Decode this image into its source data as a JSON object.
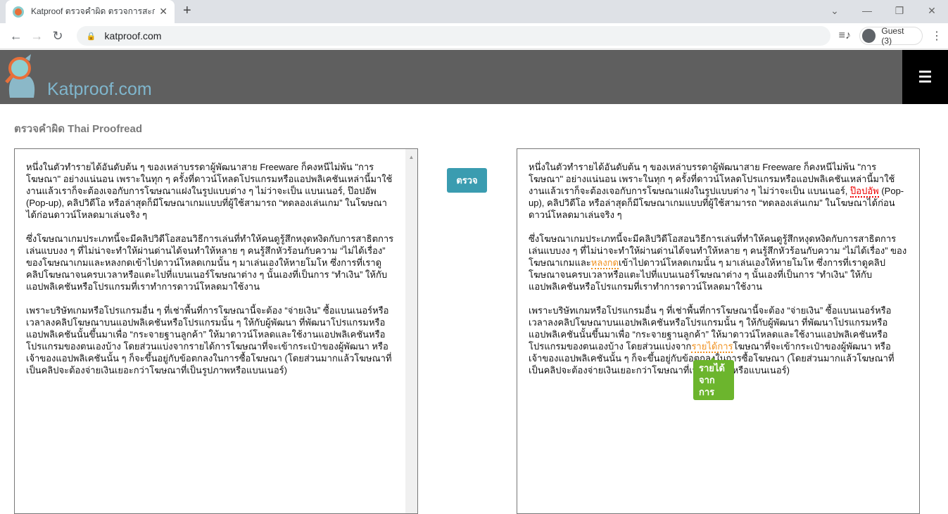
{
  "browser": {
    "tab_title": "Katproof ตรวจคำผิด ตรวจการสะกดคำ",
    "url": "katproof.com",
    "profile": "Guest (3)"
  },
  "site": {
    "brand": "Katproof.com",
    "page_title": "ตรวจคำผิด Thai Proofread",
    "check_button": "ตรวจ"
  },
  "input": {
    "paragraphs": [
      "หนึ่งในตัวทำรายได้อันดับต้น ๆ ของเหล่าบรรดาผู้พัฒนาสาย Freeware ก็คงหนีไม่พ้น \"การโฆษณา\" อย่างแน่นอน เพราะในทุก ๆ ครั้งที่ดาวน์โหลดโปรแกรมหรือแอปพลิเคชันเหล่านี้มาใช้งานแล้วเราก็จะต้องเจอกับการโฆษณาแฝงในรูปแบบต่าง ๆ ไม่ว่าจะเป็น แบนเนอร์, ป๊อปอัพ (Pop-up), คลิปวิดีโอ หรือล่าสุดก็มีโฆษณาเกมแบบที่ผู้ใช้สามารถ “ทดลองเล่นเกม” ในโฆษณาได้ก่อนดาวน์โหลดมาเล่นจริง ๆ",
      "ซึ่งโฆษณาเกมประเภทนี้จะมีคลิปวิดีโอสอนวิธีการเล่นที่ทำให้คนดูรู้สึกหงุดหงิดกับการสาธิตการเล่นแบบงง ๆ ที่ไม่น่าจะทำให้ผ่านด่านได้จนทำให้หลาย ๆ คนรู้สึกหัวร้อนกับความ “ไม่ได้เรื่อง” ของโฆษณาเกมและหลงกดเข้าไปดาวน์โหลดเกมนั้น ๆ มาเล่นเองให้หายโมโห ซึ่งการที่เราดูคลิปโฆษณาจนครบเวลาหรือแตะไปที่แบนเนอร์โฆษณาต่าง ๆ นั้นเองที่เป็นการ “ทำเงิน” ให้กับแอปพลิเคชันหรือโปรแกรมที่เราทำการดาวน์โหลดมาใช้งาน",
      "เพราะบริษัทเกมหรือโปรแกรมอื่น ๆ ที่เช่าพื้นที่การโฆษณานี้จะต้อง “จ่ายเงิน” ซื้อแบนเนอร์หรือเวลาลงคลิปโฆษณาบนแอปพลิเคชันหรือโปรแกรมนั้น ๆ ให้กับผู้พัฒนา ที่พัฒนาโปรแกรมหรือแอปพลิเคชันนั้นขึ้นมาเพื่อ “กระจายฐานลูกค้า” ให้มาดาวน์โหลดและใช้งานแอปพลิเคชันหรือโปรแกรมของตนเองบ้าง โดยส่วนแบ่งจากรายได้การโฆษณาที่จะเข้ากระเป๋าของผู้พัฒนา หรือ เจ้าของแอปพลิเคชันนั้น ๆ ก็จะขึ้นอยู่กับข้อตกลงในการซื้อโฆษณา (โดยส่วนมากแล้วโฆษณาที่เป็นคลิปจะต้องจ่ายเงินเยอะกว่าโฆษณาที่เป็นรูปภาพหรือแบนเนอร์)"
    ]
  },
  "output": {
    "p1": [
      "หนึ่งในตัวทำรายได้อันดับต้น ๆ ของเหล่าบรรดาผู้พัฒนาสาย Freeware ก็คงหนีไม่พ้น \"การโฆษณา\" อย่างแน่นอน เพราะในทุก ๆ ครั้งที่ดาวน์โหลดโปรแกรมหรือแอปพลิเคชันเหล่านี้มาใช้งานแล้วเราก็จะต้องเจอกับการโฆษณาแฝงในรูปแบบต่าง ๆ ไม่ว่าจะเป็น แบนเนอร์, ",
      "ป๊อปอัพ",
      " (Pop-up), คลิปวิดีโอ หรือล่าสุดก็มีโฆษณาเกมแบบที่ผู้ใช้สามารถ “ทดลองเล่นเกม” ในโฆษณาได้ก่อนดาวน์โหลดมาเล่นจริง ๆ"
    ],
    "p2": [
      "ซึ่งโฆษณาเกมประเภทนี้จะมีคลิปวิดีโอสอนวิธีการเล่นที่ทำให้คนดูรู้สึกหงุดหงิดกับการสาธิตการเล่นแบบงง ๆ ที่ไม่น่าจะทำให้ผ่านด่านได้จนทำให้หลาย ๆ คนรู้สึกหัวร้อนกับความ “ไม่ได้เรื่อง” ของโฆษณาเกมและ",
      "หลงกด",
      "เข้าไปดาวน์โหลดเกมนั้น ๆ มาเล่นเองให้หายโมโห ซึ่งการที่เราดูคลิปโฆษณาจนครบเวลาหรือแตะไปที่แบนเนอร์โฆษณาต่าง ๆ นั้นเองที่เป็นการ “ทำเงิน” ให้กับแอปพลิเคชันหรือโปรแกรมที่เราทำการดาวน์โหลดมาใช้งาน"
    ],
    "p3": [
      "เพราะบริษัทเกมหรือโปรแกรมอื่น ๆ ที่เช่าพื้นที่การโฆษณานี้จะต้อง “จ่ายเงิน” ซื้อแบนเนอร์หรือเวลาลงคลิปโฆษณาบนแอปพลิเคชันหรือโปรแกรมนั้น ๆ ให้กับผู้พัฒนา ที่พัฒนาโปรแกรมหรือแอปพลิเคชันนั้นขึ้นมาเพื่อ “กระจายฐานลูกค้า” ให้มาดาวน์โหลดและใช้งานแอปพลิเคชันหรือโปรแกรมของตนเองบ้าง โดยส่วนแบ่งจาก",
      "รายได้การ",
      "โฆษณาที่จะเข้ากระเป๋าของผู้พัฒนา หรือ เจ้าของแอปพลิเคชันนั้น ๆ ก็จะขึ้นอยู่กับข้อตกลงในการซื้อโฆษณา (โดยส่วนมากแล้วโฆษณาที่เป็นคลิปจะต้องจ่ายเงินเยอะกว่าโฆษณาที่เป็นรูปภาพหรือแบนเนอร์)"
    ],
    "tooltip": "รายได้ จาก การ"
  },
  "colors": {
    "error_red": "#e00000",
    "warning_orange": "#f0901e",
    "tooltip_green": "#6cb52d",
    "button": "#3a9cb0"
  }
}
